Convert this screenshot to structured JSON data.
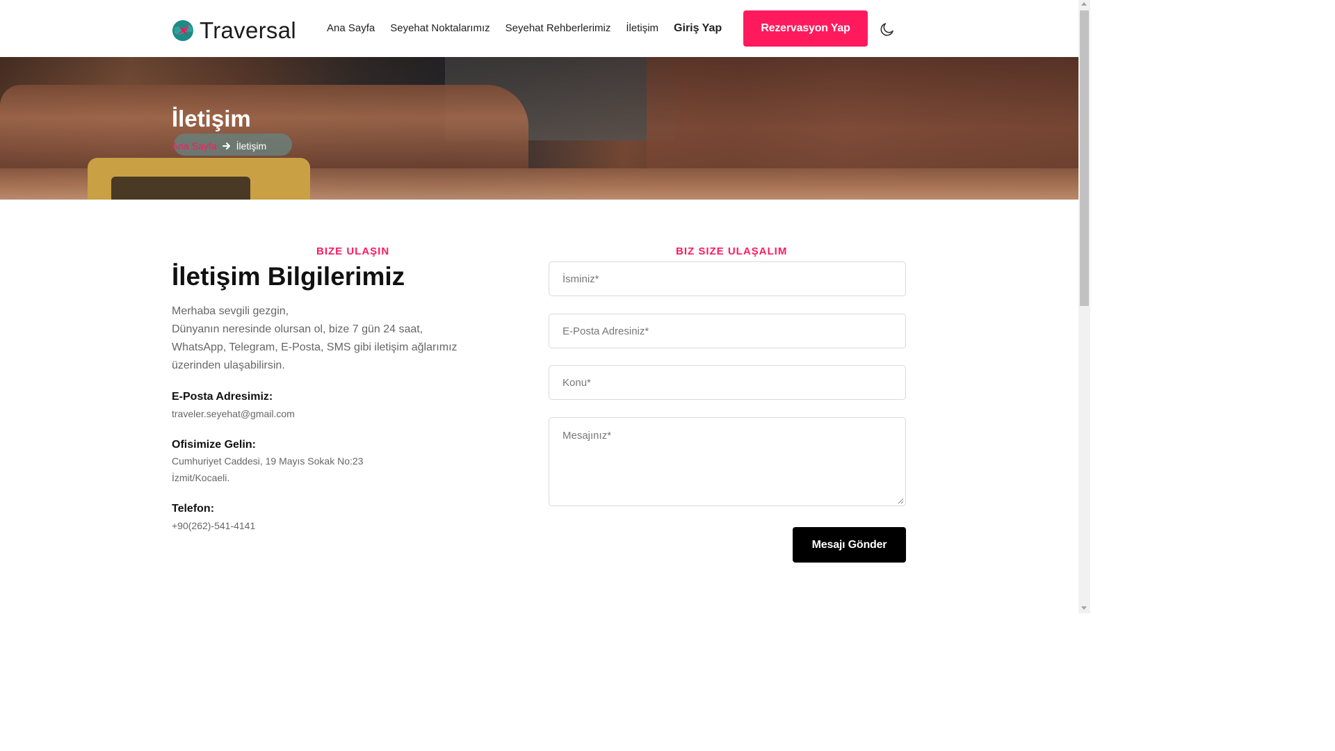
{
  "header": {
    "brand": "Traversal",
    "nav": [
      "Ana Sayfa",
      "Seyehat Noktalarımız",
      "Seyehat Rehberlerimiz",
      "İletişim",
      "Giriş Yap"
    ],
    "reserve_label": "Rezervasyon Yap",
    "theme_icon": "moon-icon"
  },
  "hero": {
    "title": "İletişim",
    "breadcrumb": {
      "home": "Ana Sayfa",
      "separator_icon": "arrow-right-icon",
      "current": "İletişim"
    }
  },
  "contact_info": {
    "eyebrow": "BIZE ULAŞIN",
    "title": "İletişim Bilgilerimiz",
    "intro_lines": [
      "Merhaba sevgili gezgin,",
      "Dünyanın neresinde olursan ol, bize 7 gün 24 saat,",
      "WhatsApp, Telegram, E-Posta, SMS gibi iletişim ağlarımız",
      "üzerinden ulaşabilirsin."
    ],
    "email_label": "E-Posta Adresimiz:",
    "email_value": "traveler.seyehat@gmail.com",
    "office_label": "Ofisimize Gelin:",
    "office_lines": [
      "Cumhuriyet Caddesi, 19 Mayıs Sokak No:23",
      "İzmit/Kocaeli."
    ],
    "phone_label": "Telefon:",
    "phone_value": "+90(262)-541-4141"
  },
  "form": {
    "eyebrow": "BIZ SIZE ULAŞALIM",
    "name_placeholder": "İsminiz*",
    "email_placeholder": "E-Posta Adresiniz*",
    "subject_placeholder": "Konu*",
    "message_placeholder": "Mesajınız*",
    "submit_label": "Mesajı Gönder"
  },
  "colors": {
    "accent": "#ff1a5e",
    "button_dark": "#000000",
    "muted_text": "#666666"
  }
}
